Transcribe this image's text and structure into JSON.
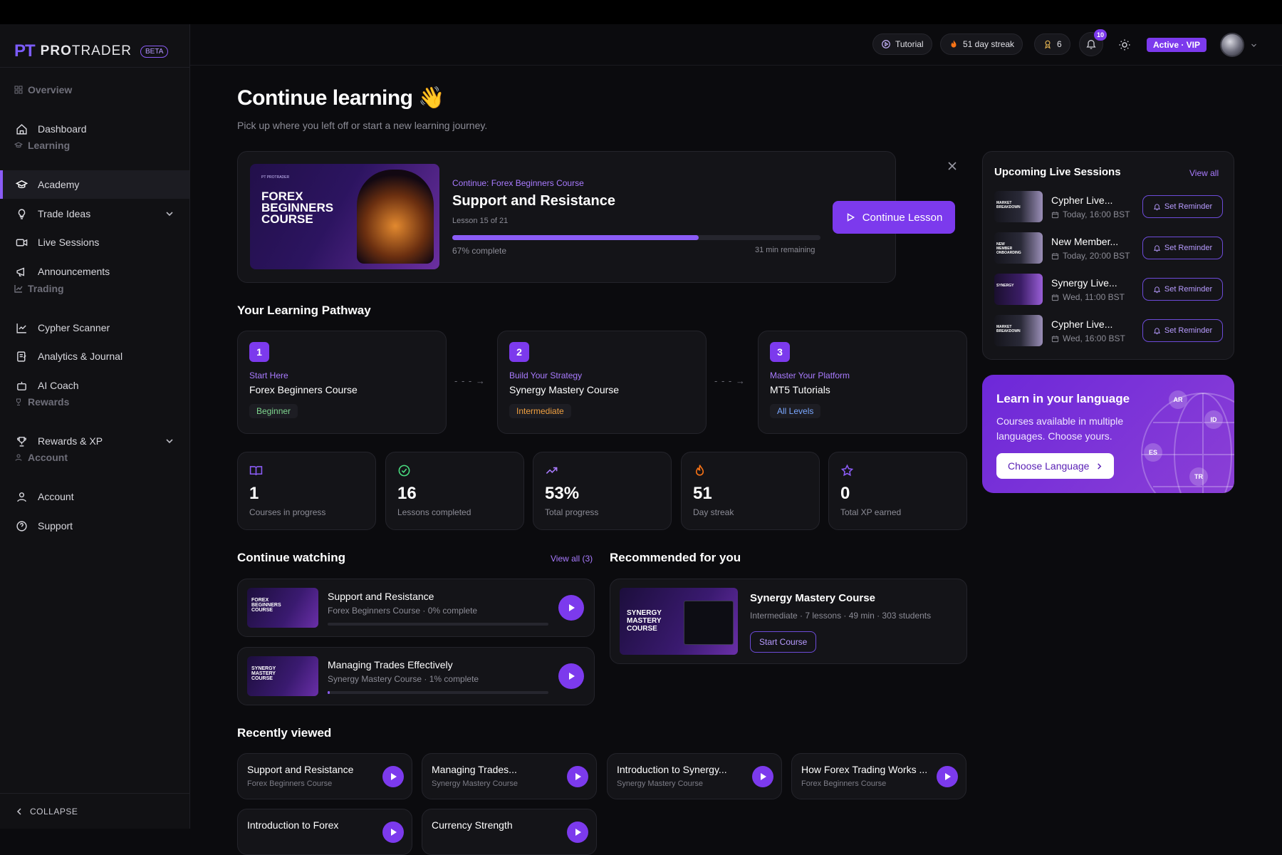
{
  "brand": {
    "logo": "PT",
    "name_bold": "PRO",
    "name_rest": "TRADER",
    "beta": "BETA"
  },
  "sidebar": {
    "sections": [
      {
        "label": "Overview",
        "icon": "grid-icon"
      },
      {
        "label": "Learning",
        "icon": "graduation-cap-icon"
      },
      {
        "label": "Trading",
        "icon": "chart-icon"
      },
      {
        "label": "Rewards",
        "icon": "trophy-icon"
      },
      {
        "label": "Account",
        "icon": "user-icon"
      }
    ],
    "items": [
      {
        "label": "Dashboard",
        "icon": "home-icon"
      },
      {
        "label": "Academy",
        "icon": "graduation-cap-icon",
        "active": true
      },
      {
        "label": "Trade Ideas",
        "icon": "lightbulb-icon",
        "expandable": true
      },
      {
        "label": "Live Sessions",
        "icon": "video-icon"
      },
      {
        "label": "Announcements",
        "icon": "megaphone-icon"
      },
      {
        "label": "Cypher Scanner",
        "icon": "line-chart-icon"
      },
      {
        "label": "Analytics & Journal",
        "icon": "journal-icon"
      },
      {
        "label": "AI Coach",
        "icon": "robot-icon"
      },
      {
        "label": "Rewards & XP",
        "icon": "trophy-icon",
        "expandable": true
      },
      {
        "label": "Account",
        "icon": "user-icon"
      },
      {
        "label": "Support",
        "icon": "help-icon"
      }
    ],
    "collapse_label": "COLLAPSE"
  },
  "topbar": {
    "tutorial": "Tutorial",
    "streak": "51 day streak",
    "awards": "6",
    "notifications": "10",
    "vip": "Active · VIP"
  },
  "header": {
    "title": "Continue learning 👋",
    "subtitle": "Pick up where you left off or start a new learning journey."
  },
  "hero": {
    "thumb_title": "FOREX BEGINNERS COURSE",
    "thumb_brand": "PT PROTRADER",
    "course_label": "Continue: Forex Beginners Course",
    "lesson_title": "Support and Resistance",
    "lesson_count": "Lesson 15 of 21",
    "progress": 0.67,
    "progress_label": "67% complete",
    "remaining": "31 min remaining",
    "cta": "Continue Lesson"
  },
  "pathway": {
    "title": "Your Learning Pathway",
    "steps": [
      {
        "num": "1",
        "stage": "Start Here",
        "course": "Forex Beginners Course",
        "level": "Beginner",
        "level_color": "#7fd68f"
      },
      {
        "num": "2",
        "stage": "Build Your Strategy",
        "course": "Synergy Mastery Course",
        "level": "Intermediate",
        "level_color": "#f0a040"
      },
      {
        "num": "3",
        "stage": "Master Your Platform",
        "course": "MT5 Tutorials",
        "level": "All Levels",
        "level_color": "#7aa7ff"
      }
    ]
  },
  "stats": [
    {
      "value": "1",
      "label": "Courses in progress",
      "icon": "book-icon",
      "color": "#8b5cf6"
    },
    {
      "value": "16",
      "label": "Lessons completed",
      "icon": "check-circle-icon",
      "color": "#4ade80"
    },
    {
      "value": "53%",
      "label": "Total progress",
      "icon": "trending-up-icon",
      "color": "#a97bff"
    },
    {
      "value": "51",
      "label": "Day streak",
      "icon": "flame-icon",
      "color": "#f97316"
    },
    {
      "value": "0",
      "label": "Total XP earned",
      "icon": "star-icon",
      "color": "#8b5cf6"
    }
  ],
  "continue_watching": {
    "title": "Continue watching",
    "view_all": "View all (3)",
    "items": [
      {
        "title": "Support and Resistance",
        "meta": "Forex Beginners Course · 0% complete",
        "thumb": "FOREX BEGINNERS COURSE",
        "progress": 0
      },
      {
        "title": "Managing Trades Effectively",
        "meta": "Synergy Mastery Course · 1% complete",
        "thumb": "SYNERGY MASTERY COURSE",
        "progress": 0.01
      }
    ]
  },
  "recommended": {
    "title": "Recommended for you",
    "course": "Synergy Mastery Course",
    "meta": "Intermediate · 7 lessons · 49 min · 303 students",
    "cta": "Start Course",
    "thumb": "SYNERGY MASTERY COURSE"
  },
  "recent": {
    "title": "Recently viewed",
    "items": [
      {
        "title": "Support and Resistance",
        "course": "Forex Beginners Course"
      },
      {
        "title": "Managing Trades...",
        "course": "Synergy Mastery Course"
      },
      {
        "title": "Introduction to Synergy...",
        "course": "Synergy Mastery Course"
      },
      {
        "title": "How Forex Trading Works ...",
        "course": "Forex Beginners Course"
      },
      {
        "title": "Introduction to Forex",
        "course": ""
      },
      {
        "title": "Currency Strength",
        "course": ""
      }
    ]
  },
  "sessions": {
    "title": "Upcoming Live Sessions",
    "view_all": "View all",
    "reminder": "Set Reminder",
    "items": [
      {
        "title": "Cypher Live...",
        "time": "Today, 16:00 BST",
        "thumb": "MARKET BREAKDOWN"
      },
      {
        "title": "New Member...",
        "time": "Today, 20:00 BST",
        "thumb": "NEW MEMBER ONBOARDING"
      },
      {
        "title": "Synergy Live...",
        "time": "Wed, 11:00 BST",
        "thumb": "SYNERGY"
      },
      {
        "title": "Cypher Live...",
        "time": "Wed, 16:00 BST",
        "thumb": "MARKET BREAKDOWN"
      }
    ]
  },
  "language": {
    "title": "Learn in your language",
    "body": "Courses available in multiple languages. Choose yours.",
    "cta": "Choose Language",
    "codes": [
      "AR",
      "ID",
      "ES",
      "TR"
    ]
  }
}
